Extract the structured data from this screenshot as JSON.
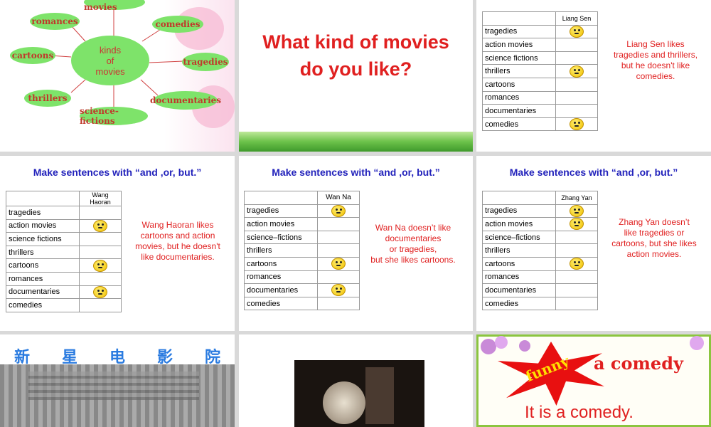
{
  "slide1": {
    "center": [
      "kinds",
      "of",
      "movies"
    ],
    "nodes": {
      "action": "action movies",
      "romances": "romances",
      "comedies": "comedies",
      "cartoons": "cartoons",
      "tragedies": "tragedies",
      "thrillers": "thrillers",
      "documentaries": "documentaries",
      "science": "science-fictions"
    }
  },
  "slide2": {
    "title_line1": "What kind of movies",
    "title_line2": "do you like?"
  },
  "slide3": {
    "header": "Liang Sen",
    "rows": [
      "tragedies",
      "action movies",
      "science fictions",
      "thrillers",
      "cartoons",
      "romances",
      "documentaries",
      "comedies"
    ],
    "note": [
      "Liang Sen likes",
      "tragedies and thrillers,",
      "but he doesn't like",
      "comedies."
    ]
  },
  "slide4": {
    "heading": "Make sentences with “and ,or, but.”",
    "header": "Wang Haoran",
    "rows": [
      "tragedies",
      "action movies",
      "science fictions",
      "thrillers",
      "cartoons",
      "romances",
      "documentaries",
      "comedies"
    ],
    "note": [
      "Wang Haoran likes",
      "cartoons and action",
      "movies, but he doesn't",
      "like documentaries."
    ]
  },
  "slide5": {
    "heading": "Make sentences with “and ,or, but.”",
    "header": "Wan Na",
    "rows": [
      "tragedies",
      "action movies",
      "science–fictions",
      "thrillers",
      "cartoons",
      "romances",
      "documentaries",
      "comedies"
    ],
    "note": [
      "Wan Na doesn’t like",
      "documentaries",
      "or tragedies,",
      "but she likes cartoons."
    ]
  },
  "slide6": {
    "heading": "Make sentences with “and ,or, but.”",
    "header": "Zhang Yan",
    "rows": [
      "tragedies",
      "action movies",
      "science–fictions",
      "thrillers",
      "cartoons",
      "romances",
      "documentaries",
      "comedies"
    ],
    "note": [
      "Zhang Yan doesn’t",
      "like tragedies or",
      "cartoons, but she likes",
      "action movies."
    ]
  },
  "slide7": {
    "chars": [
      "新",
      "星",
      "电",
      "影",
      "院"
    ]
  },
  "slide9": {
    "funny": "funny",
    "comedy": "a comedy",
    "sentence": "It is a comedy."
  }
}
